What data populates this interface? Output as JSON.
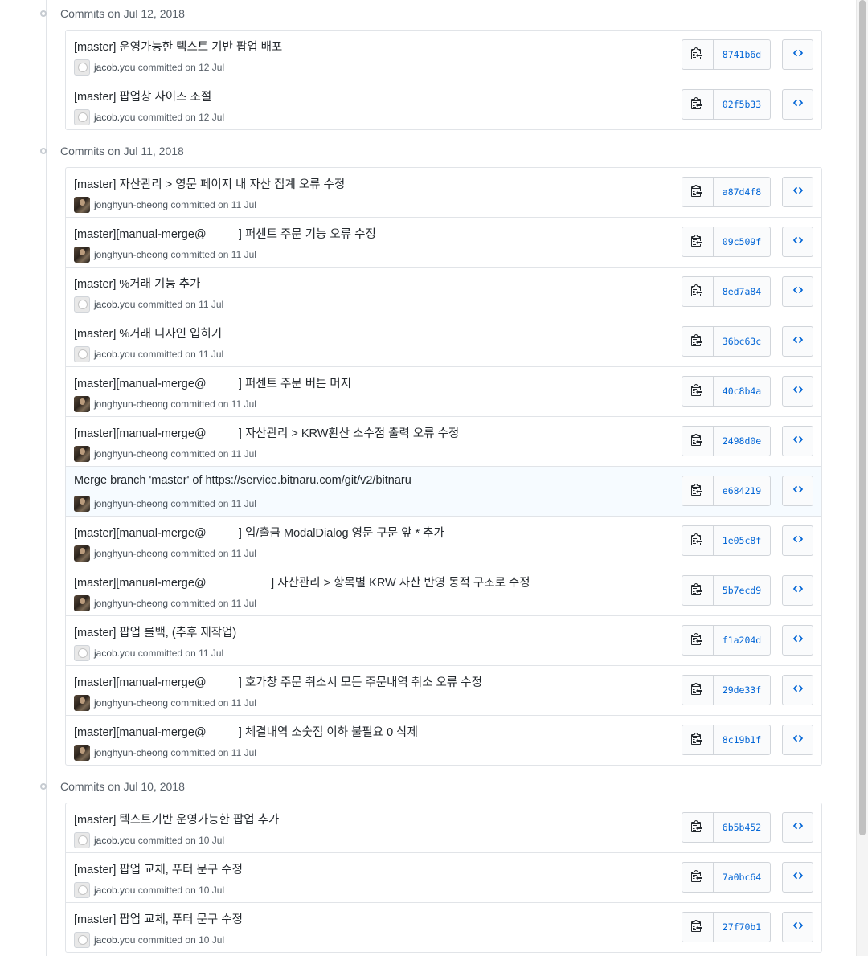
{
  "groups": [
    {
      "title": "Commits on Jul 12, 2018",
      "commits": [
        {
          "message": "[master] 운영가능한 텍스트 기반 팝업 배포",
          "author": "jacob.you",
          "avatar": "github-default-avatar",
          "committed": "committed on 12 Jul",
          "sha": "8741b6d"
        },
        {
          "message": "[master] 팝업창 사이즈 조절",
          "author": "jacob.you",
          "avatar": "github-default-avatar",
          "committed": "committed on 12 Jul",
          "sha": "02f5b33"
        }
      ]
    },
    {
      "title": "Commits on Jul 11, 2018",
      "commits": [
        {
          "message": "[master] 자산관리 > 영문 페이지 내 자산 집계 오류 수정",
          "author": "jonghyun-cheong",
          "avatar": "photo-avatar",
          "committed": "committed on 11 Jul",
          "sha": "a87d4f8"
        },
        {
          "message": "[master][manual-merge@          ] 퍼센트 주문 기능 오류 수정",
          "author": "jonghyun-cheong",
          "avatar": "photo-avatar",
          "committed": "committed on 11 Jul",
          "sha": "09c509f"
        },
        {
          "message": "[master] %거래 기능 추가",
          "author": "jacob.you",
          "avatar": "github-default-avatar",
          "committed": "committed on 11 Jul",
          "sha": "8ed7a84"
        },
        {
          "message": "[master] %거래 디자인 입히기",
          "author": "jacob.you",
          "avatar": "github-default-avatar",
          "committed": "committed on 11 Jul",
          "sha": "36bc63c"
        },
        {
          "message": "[master][manual-merge@          ] 퍼센트 주문 버튼 머지",
          "author": "jonghyun-cheong",
          "avatar": "photo-avatar",
          "committed": "committed on 11 Jul",
          "sha": "40c8b4a"
        },
        {
          "message": "[master][manual-merge@          ] 자산관리 > KRW환산 소수점 출력 오류 수정",
          "author": "jonghyun-cheong",
          "avatar": "photo-avatar",
          "committed": "committed on 11 Jul",
          "sha": "2498d0e"
        },
        {
          "message": "Merge branch 'master' of https://service.bitnaru.com/git/v2/bitnaru",
          "author": "jonghyun-cheong",
          "avatar": "photo-avatar",
          "committed": "committed on 11 Jul",
          "sha": "e684219",
          "highlight": true
        },
        {
          "message": "[master][manual-merge@          ] 입/출금 ModalDialog 영문 구문 앞 * 추가",
          "author": "jonghyun-cheong",
          "avatar": "photo-avatar",
          "committed": "committed on 11 Jul",
          "sha": "1e05c8f"
        },
        {
          "message": "[master][manual-merge@                    ] 자산관리 > 항목별 KRW 자산 반영 동적 구조로 수정",
          "author": "jonghyun-cheong",
          "avatar": "photo-avatar",
          "committed": "committed on 11 Jul",
          "sha": "5b7ecd9"
        },
        {
          "message": "[master] 팝업 롤백, (추후 재작업)",
          "author": "jacob.you",
          "avatar": "github-default-avatar",
          "committed": "committed on 11 Jul",
          "sha": "f1a204d"
        },
        {
          "message": "[master][manual-merge@          ] 호가창 주문 취소시 모든 주문내역 취소 오류 수정",
          "author": "jonghyun-cheong",
          "avatar": "photo-avatar",
          "committed": "committed on 11 Jul",
          "sha": "29de33f"
        },
        {
          "message": "[master][manual-merge@          ] 체결내역 소숫점 이하 불필요 0 삭제",
          "author": "jonghyun-cheong",
          "avatar": "photo-avatar",
          "committed": "committed on 11 Jul",
          "sha": "8c19b1f"
        }
      ]
    },
    {
      "title": "Commits on Jul 10, 2018",
      "commits": [
        {
          "message": "[master] 텍스트기반 운영가능한 팝업 추가",
          "author": "jacob.you",
          "avatar": "github-default-avatar",
          "committed": "committed on 10 Jul",
          "sha": "6b5b452"
        },
        {
          "message": "[master] 팝업 교체, 푸터 문구 수정",
          "author": "jacob.you",
          "avatar": "github-default-avatar",
          "committed": "committed on 10 Jul",
          "sha": "7a0bc64"
        },
        {
          "message": "[master] 팝업 교체, 푸터 문구 수정",
          "author": "jacob.you",
          "avatar": "github-default-avatar",
          "committed": "committed on 10 Jul",
          "sha": "27f70b1"
        }
      ]
    }
  ],
  "icons": {
    "copy": "clippy-icon",
    "browse": "code-icon"
  },
  "colors": {
    "sha_link": "#0366d6",
    "border": "#e1e4e8",
    "highlight_row": "#f6fbff"
  }
}
